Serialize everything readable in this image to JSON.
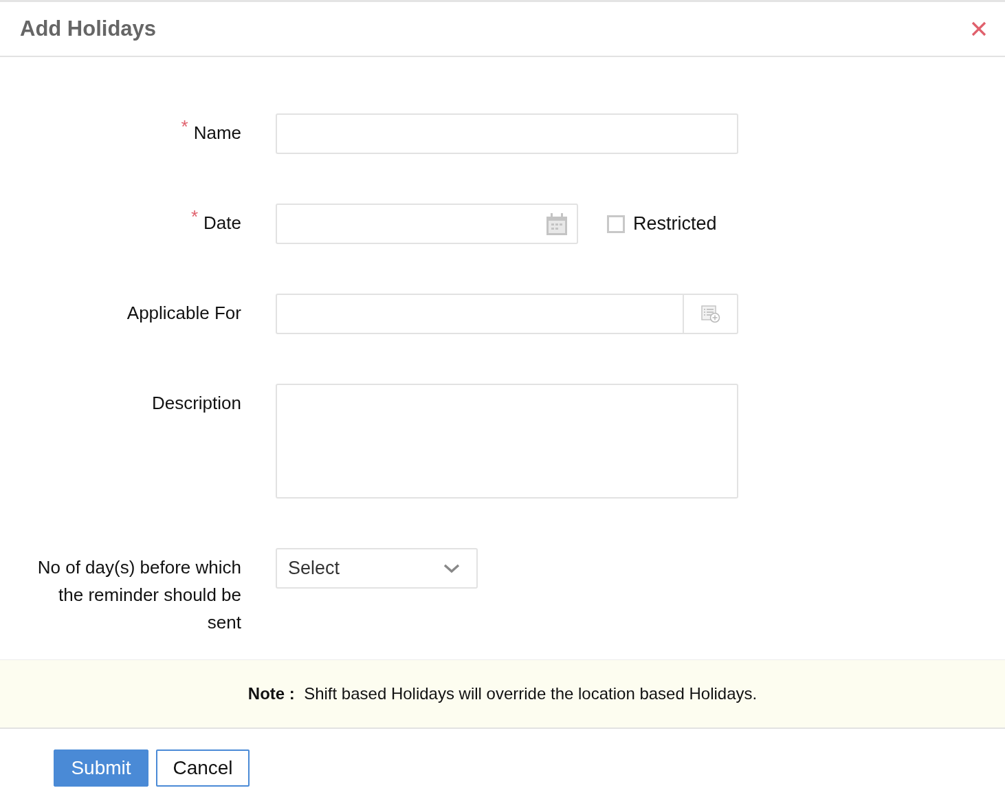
{
  "dialog": {
    "title": "Add Holidays"
  },
  "fields": [
    {
      "kind": "text",
      "label": "Name",
      "required_mark": "*"
    },
    {
      "kind": "date",
      "label": "Date",
      "required_mark": "*",
      "checkbox": {
        "label": "Restricted",
        "checked": false
      }
    },
    {
      "kind": "picker",
      "label": "Applicable For"
    },
    {
      "kind": "textarea",
      "label": "Description"
    },
    {
      "kind": "select",
      "label": "No of day(s) before which the reminder should be sent",
      "placeholder": "Select"
    }
  ],
  "note": {
    "label": "Note :",
    "text": "Shift based Holidays will override the location based Holidays."
  },
  "buttons": [
    {
      "kind": "primary",
      "label": "Submit"
    },
    {
      "kind": "secondary",
      "label": "Cancel"
    }
  ]
}
